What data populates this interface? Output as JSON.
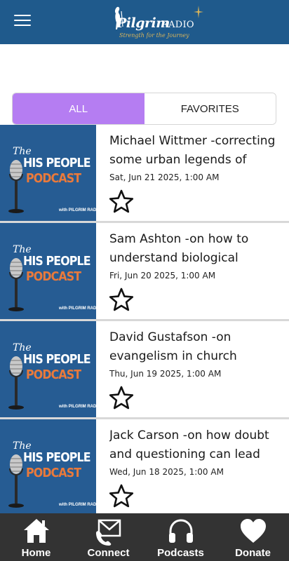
{
  "header": {
    "menu_icon": "hamburger-menu-icon",
    "logo": {
      "word": "Pilgrim",
      "radio": "RADIO",
      "tagline": "Strength for the Journey",
      "accent_color": "#d9b45a"
    },
    "background": "#1f5a8c"
  },
  "tabs": [
    {
      "label": "ALL",
      "active": true
    },
    {
      "label": "FAVORITES",
      "active": false
    }
  ],
  "accent_color": "#b57df2",
  "thumbnail": {
    "the": "The",
    "line1": "HIS PEOPLE",
    "line2": "PODCAST",
    "brand": "with PILGRIM RADIO"
  },
  "episodes": [
    {
      "title": "Michael Wittmer -correcting some urban legends of",
      "date": "Sat, Jun 21 2025, 1:00 AM",
      "favorite": false
    },
    {
      "title": "Sam Ashton -on how to understand biological",
      "date": "Fri, Jun 20 2025, 1:00 AM",
      "favorite": false
    },
    {
      "title": "David Gustafson -on evangelism in church",
      "date": "Thu, Jun 19 2025, 1:00 AM",
      "favorite": false
    },
    {
      "title": "Jack Carson -on how doubt and questioning can lead",
      "date": "Wed, Jun 18 2025, 1:00 AM",
      "favorite": false
    }
  ],
  "bottom_nav": [
    {
      "label": "Home",
      "icon": "home-icon"
    },
    {
      "label": "Connect",
      "icon": "mail-phone-icon"
    },
    {
      "label": "Podcasts",
      "icon": "headphones-icon"
    },
    {
      "label": "Donate",
      "icon": "heart-icon"
    }
  ]
}
